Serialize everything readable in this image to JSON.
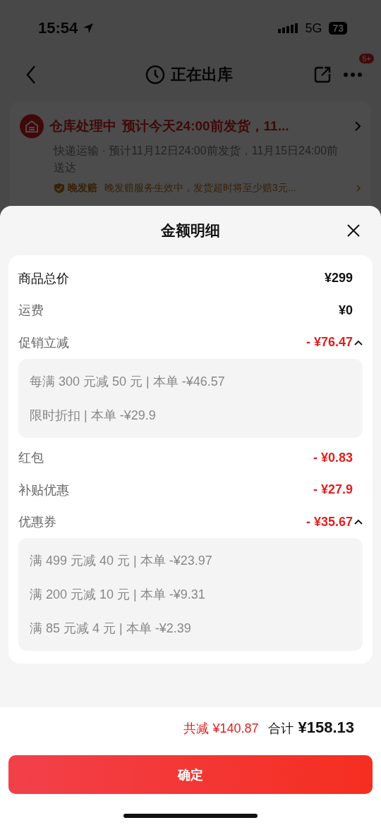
{
  "status_bar": {
    "time": "15:54",
    "network": "5G",
    "battery": "73"
  },
  "nav": {
    "title": "正在出库",
    "badge": "5+"
  },
  "shipment": {
    "title": "仓库处理中",
    "headline": "预计今天24:00前发货，11...",
    "detail": "快递运输 · 预计11月12日24:00前发货，11月15日24:00前送达",
    "guarantee_label": "晚发赔",
    "guarantee_text": "晚发赔服务生效中，发货超时将至少赔3元..."
  },
  "sheet": {
    "title": "金额明细",
    "rows": [
      {
        "kind": "total",
        "label": "商品总价",
        "amount": "¥299"
      },
      {
        "kind": "fee",
        "label": "运费",
        "amount": "¥0"
      },
      {
        "kind": "discount",
        "label": "促销立减",
        "amount": "- ¥76.47",
        "expanded": true,
        "details": [
          "每满 300 元减 50 元 | 本单 -¥46.57",
          "限时折扣 | 本单 -¥29.9"
        ]
      },
      {
        "kind": "discount",
        "label": "红包",
        "amount": "- ¥0.83"
      },
      {
        "kind": "discount",
        "label": "补贴优惠",
        "amount": "- ¥27.9"
      },
      {
        "kind": "discount",
        "label": "优惠券",
        "amount": "- ¥35.67",
        "expanded": true,
        "details": [
          "满 499 元减 40 元 | 本单 -¥23.97",
          "满 200 元减 10 元 | 本单 -¥9.31",
          "满 85 元减 4 元 | 本单 -¥2.39"
        ]
      }
    ],
    "saved": "共减 ¥140.87",
    "total_label": "合计",
    "total": "¥158.13",
    "confirm": "确定"
  }
}
